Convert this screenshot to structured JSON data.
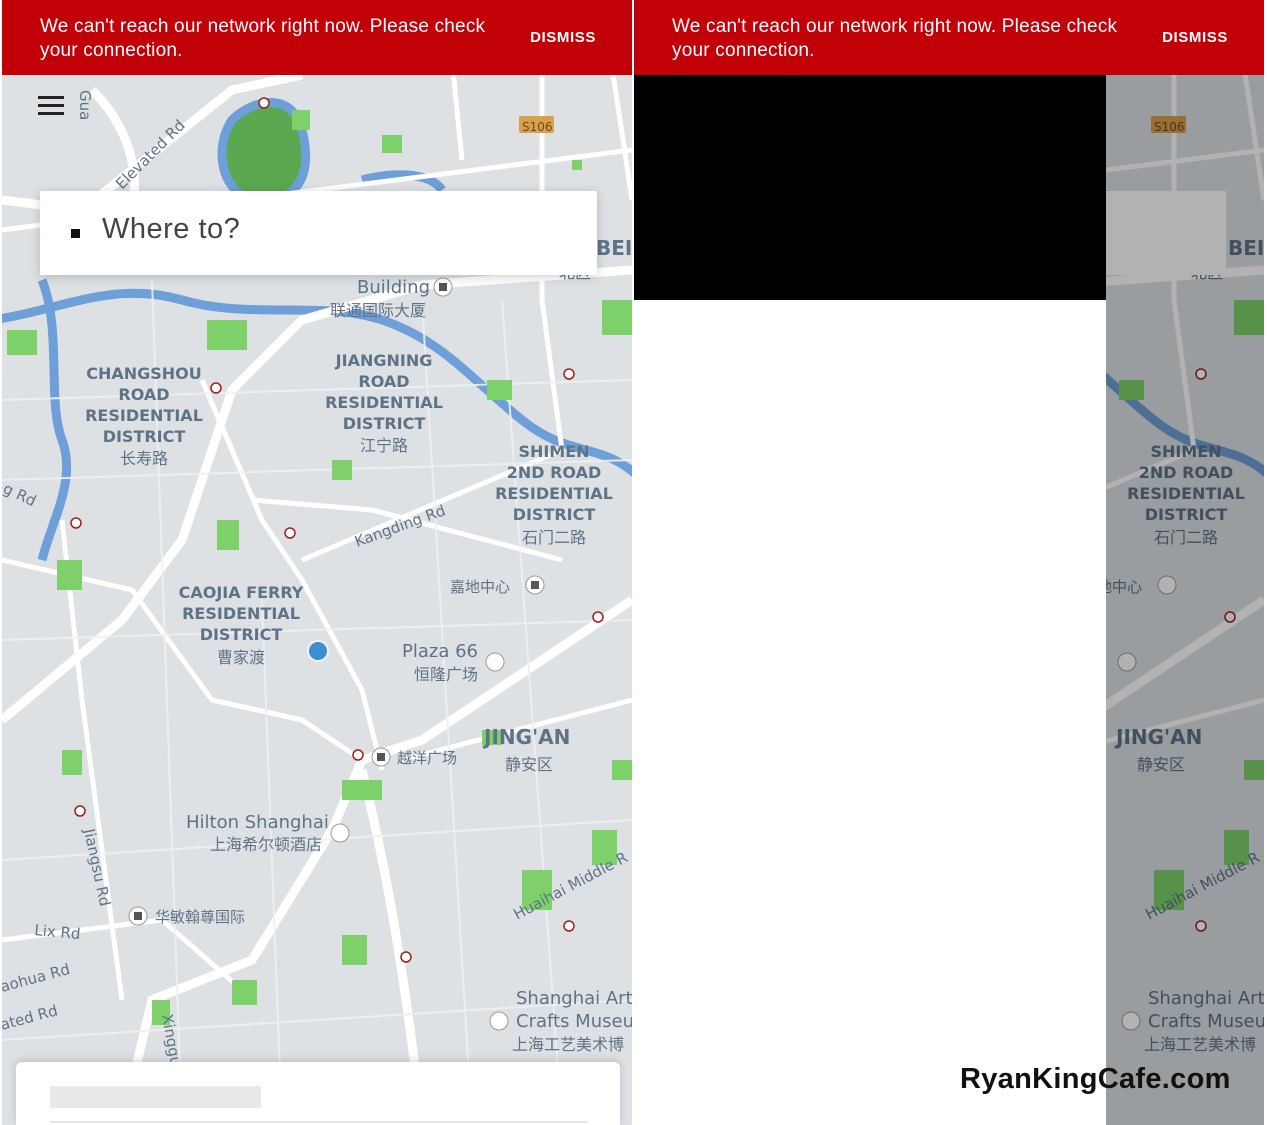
{
  "banner": {
    "message": "We can't reach our network right now. Please check your connection.",
    "dismiss_label": "DISMISS"
  },
  "search": {
    "placeholder": "Where to?"
  },
  "map": {
    "labels": {
      "gua": "Gua",
      "elevated_rd": "Elevated Rd",
      "s106": "S106",
      "bei": "BEI",
      "bei_qu": "北区",
      "building": "Building",
      "building_cn": "联通国际大厦",
      "changshou_1": "CHANGSHOU",
      "changshou_2": "ROAD",
      "changshou_3": "RESIDENTIAL",
      "changshou_4": "DISTRICT",
      "changshou_cn": "长寿路",
      "jiangning_1": "JIANGNING",
      "jiangning_2": "ROAD",
      "jiangning_3": "RESIDENTIAL",
      "jiangning_4": "DISTRICT",
      "jiangning_cn": "江宁路",
      "shimen_1": "SHIMEN",
      "shimen_2": "2ND ROAD",
      "shimen_3": "RESIDENTIAL",
      "shimen_4": "DISTRICT",
      "shimen_cn": "石门二路",
      "g_rd": "g Rd",
      "kangding": "Kangding Rd",
      "jiadi": "嘉地中心",
      "caojia_1": "CAOJIA FERRY",
      "caojia_2": "RESIDENTIAL",
      "caojia_3": "DISTRICT",
      "caojia_cn": "曹家渡",
      "plaza66": "Plaza 66",
      "plaza66_cn": "恒隆广场",
      "yueyang": "越洋广场",
      "jingan": "JING'AN",
      "jingan_cn": "静安区",
      "hilton": "Hilton Shanghai",
      "hilton_cn": "上海希尔顿酒店",
      "jiangsu": "Jiangsu Rd",
      "huamin": "华敏翰尊国际",
      "huaihai": "Huaihai Middle R",
      "lix": "Lix Rd",
      "aohua": "aohua Rd",
      "ated": "ated Rd",
      "xingg": "Xinggu",
      "sh_arts_1": "Shanghai Arts",
      "sh_arts_2": "Crafts Museu",
      "sh_arts_cn": "上海工艺美术博"
    }
  },
  "watermark": "RyanKingCafe.com",
  "colors": {
    "banner_red": "#c20008",
    "map_bg": "#dde1e4",
    "park_green": "#7dd06a",
    "water_blue": "#6f9fd8",
    "location_blue": "#3a8fd2",
    "label_text": "#5f7387"
  }
}
